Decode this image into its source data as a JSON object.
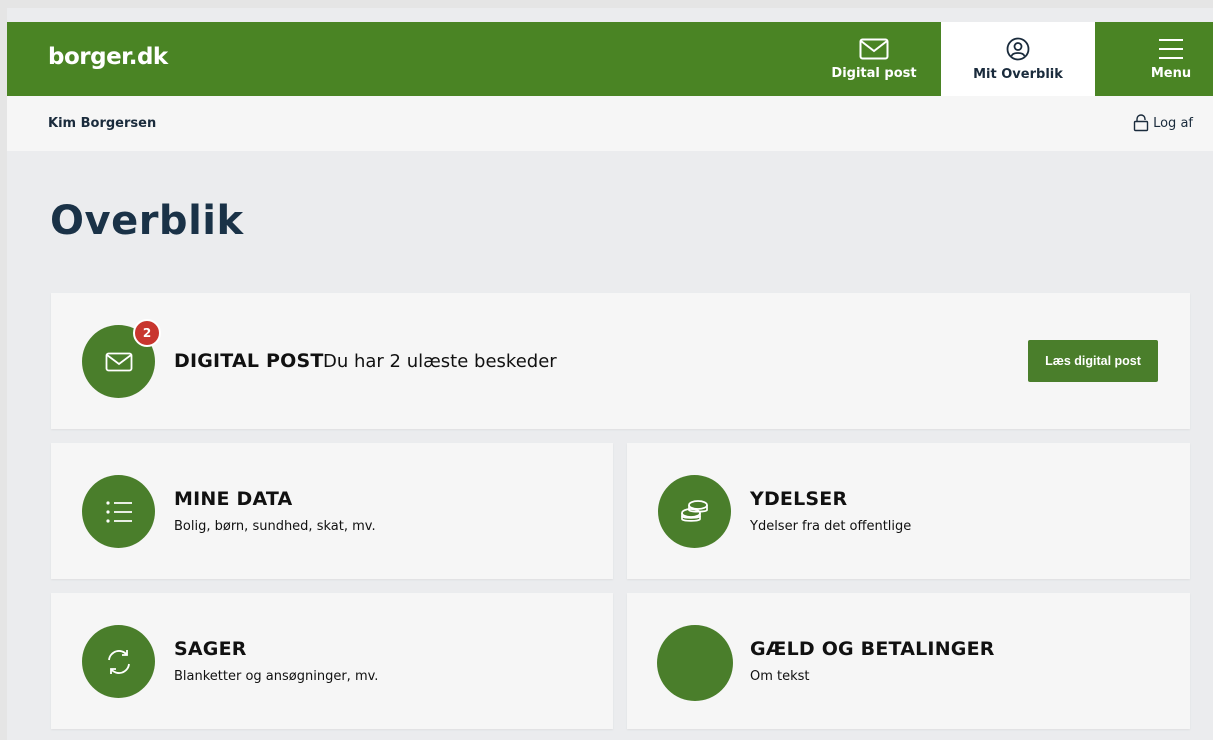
{
  "header": {
    "logo": "borger.dk",
    "nav": {
      "digital_post": "Digital post",
      "overblik": "Mit Overblik",
      "menu": "Menu"
    }
  },
  "userbar": {
    "name": "Kim Borgersen",
    "logout": "Log af"
  },
  "page": {
    "title": "Overblik"
  },
  "cards": {
    "digital_post": {
      "title": "DIGITAL POST",
      "message": "Du har 2 ulæste beskeder",
      "badge": "2",
      "button": "Læs digital post",
      "icon": "envelope-icon"
    },
    "mine_data": {
      "title": "MINE DATA",
      "subtitle": "Bolig, børn, sundhed, skat, mv.",
      "icon": "list-icon"
    },
    "ydelser": {
      "title": "YDELSER",
      "subtitle": "Ydelser fra det offentlige",
      "icon": "coins-icon"
    },
    "sager": {
      "title": "SAGER",
      "subtitle": "Blanketter og ansøgninger, mv.",
      "icon": "refresh-icon"
    },
    "gaeld": {
      "title": "GÆLD OG BETALINGER",
      "subtitle": "Om tekst"
    }
  },
  "colors": {
    "brand_green": "#4a8424",
    "icon_green": "#4a7e2b",
    "badge_red": "#c8362f",
    "title_navy": "#1a3247"
  }
}
